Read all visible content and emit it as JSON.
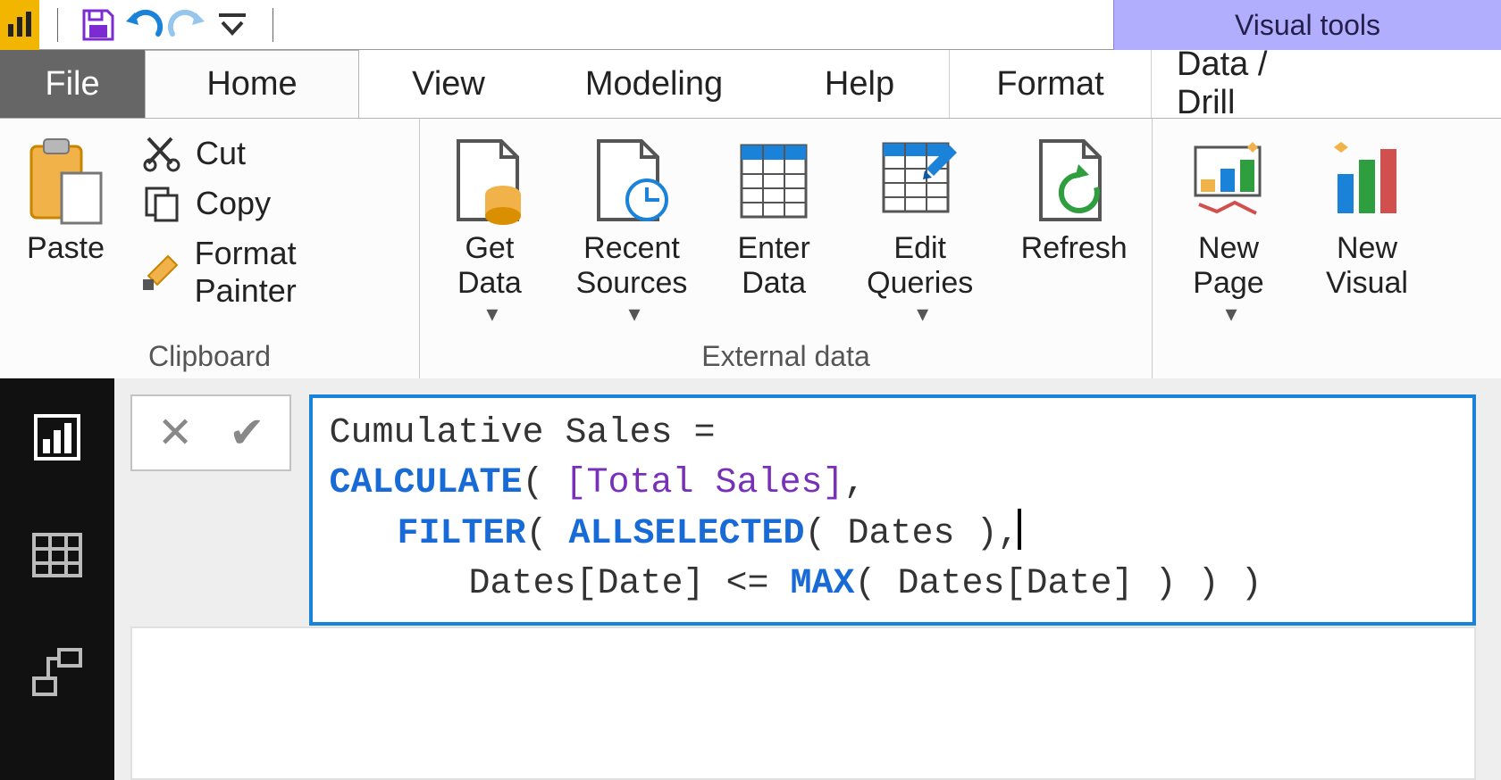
{
  "visual_tools_label": "Visual tools",
  "tabs": {
    "file": "File",
    "home": "Home",
    "view": "View",
    "modeling": "Modeling",
    "help": "Help",
    "format": "Format",
    "datadrill": "Data / Drill"
  },
  "clipboard": {
    "group_label": "Clipboard",
    "paste": "Paste",
    "cut": "Cut",
    "copy": "Copy",
    "format_painter": "Format Painter"
  },
  "external": {
    "group_label": "External data",
    "get_data": "Get\nData",
    "recent_sources": "Recent\nSources",
    "enter_data": "Enter\nData",
    "edit_queries": "Edit\nQueries",
    "refresh": "Refresh"
  },
  "insert": {
    "new_page": "New\nPage",
    "new_visual": "New\nVisual"
  },
  "formula": {
    "line1_pre": "Cumulative Sales = ",
    "calc": "CALCULATE",
    "open1": "( ",
    "measure": "[Total Sales]",
    "after_measure": ",",
    "filter": "FILTER",
    "open2": "( ",
    "allselected": "ALLSELECTED",
    "all_args": "( Dates ),",
    "line3a": "Dates[Date] <= ",
    "max": "MAX",
    "line3b": "( Dates[Date] ) ) )"
  }
}
